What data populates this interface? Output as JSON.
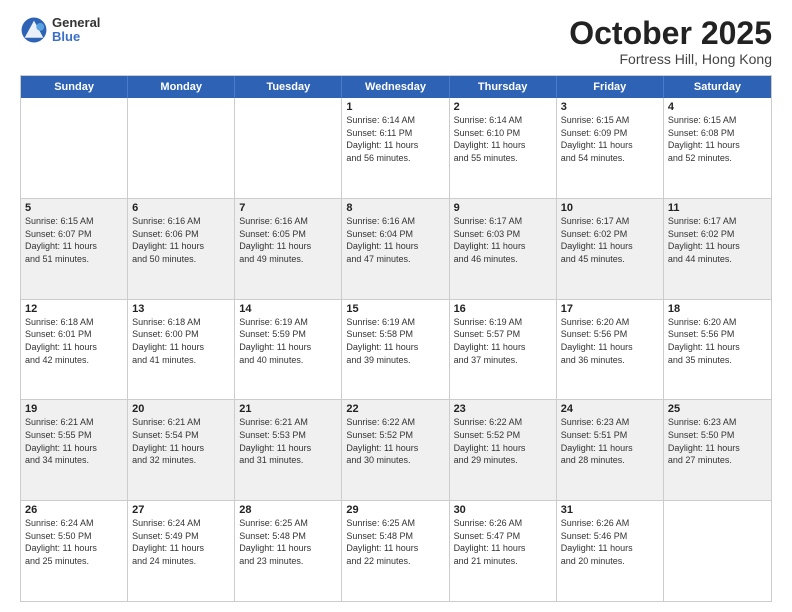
{
  "header": {
    "logo_line1": "General",
    "logo_line2": "Blue",
    "title": "October 2025",
    "location": "Fortress Hill, Hong Kong"
  },
  "days_of_week": [
    "Sunday",
    "Monday",
    "Tuesday",
    "Wednesday",
    "Thursday",
    "Friday",
    "Saturday"
  ],
  "weeks": [
    [
      {
        "day": "",
        "info": ""
      },
      {
        "day": "",
        "info": ""
      },
      {
        "day": "",
        "info": ""
      },
      {
        "day": "1",
        "info": "Sunrise: 6:14 AM\nSunset: 6:11 PM\nDaylight: 11 hours\nand 56 minutes."
      },
      {
        "day": "2",
        "info": "Sunrise: 6:14 AM\nSunset: 6:10 PM\nDaylight: 11 hours\nand 55 minutes."
      },
      {
        "day": "3",
        "info": "Sunrise: 6:15 AM\nSunset: 6:09 PM\nDaylight: 11 hours\nand 54 minutes."
      },
      {
        "day": "4",
        "info": "Sunrise: 6:15 AM\nSunset: 6:08 PM\nDaylight: 11 hours\nand 52 minutes."
      }
    ],
    [
      {
        "day": "5",
        "info": "Sunrise: 6:15 AM\nSunset: 6:07 PM\nDaylight: 11 hours\nand 51 minutes."
      },
      {
        "day": "6",
        "info": "Sunrise: 6:16 AM\nSunset: 6:06 PM\nDaylight: 11 hours\nand 50 minutes."
      },
      {
        "day": "7",
        "info": "Sunrise: 6:16 AM\nSunset: 6:05 PM\nDaylight: 11 hours\nand 49 minutes."
      },
      {
        "day": "8",
        "info": "Sunrise: 6:16 AM\nSunset: 6:04 PM\nDaylight: 11 hours\nand 47 minutes."
      },
      {
        "day": "9",
        "info": "Sunrise: 6:17 AM\nSunset: 6:03 PM\nDaylight: 11 hours\nand 46 minutes."
      },
      {
        "day": "10",
        "info": "Sunrise: 6:17 AM\nSunset: 6:02 PM\nDaylight: 11 hours\nand 45 minutes."
      },
      {
        "day": "11",
        "info": "Sunrise: 6:17 AM\nSunset: 6:02 PM\nDaylight: 11 hours\nand 44 minutes."
      }
    ],
    [
      {
        "day": "12",
        "info": "Sunrise: 6:18 AM\nSunset: 6:01 PM\nDaylight: 11 hours\nand 42 minutes."
      },
      {
        "day": "13",
        "info": "Sunrise: 6:18 AM\nSunset: 6:00 PM\nDaylight: 11 hours\nand 41 minutes."
      },
      {
        "day": "14",
        "info": "Sunrise: 6:19 AM\nSunset: 5:59 PM\nDaylight: 11 hours\nand 40 minutes."
      },
      {
        "day": "15",
        "info": "Sunrise: 6:19 AM\nSunset: 5:58 PM\nDaylight: 11 hours\nand 39 minutes."
      },
      {
        "day": "16",
        "info": "Sunrise: 6:19 AM\nSunset: 5:57 PM\nDaylight: 11 hours\nand 37 minutes."
      },
      {
        "day": "17",
        "info": "Sunrise: 6:20 AM\nSunset: 5:56 PM\nDaylight: 11 hours\nand 36 minutes."
      },
      {
        "day": "18",
        "info": "Sunrise: 6:20 AM\nSunset: 5:56 PM\nDaylight: 11 hours\nand 35 minutes."
      }
    ],
    [
      {
        "day": "19",
        "info": "Sunrise: 6:21 AM\nSunset: 5:55 PM\nDaylight: 11 hours\nand 34 minutes."
      },
      {
        "day": "20",
        "info": "Sunrise: 6:21 AM\nSunset: 5:54 PM\nDaylight: 11 hours\nand 32 minutes."
      },
      {
        "day": "21",
        "info": "Sunrise: 6:21 AM\nSunset: 5:53 PM\nDaylight: 11 hours\nand 31 minutes."
      },
      {
        "day": "22",
        "info": "Sunrise: 6:22 AM\nSunset: 5:52 PM\nDaylight: 11 hours\nand 30 minutes."
      },
      {
        "day": "23",
        "info": "Sunrise: 6:22 AM\nSunset: 5:52 PM\nDaylight: 11 hours\nand 29 minutes."
      },
      {
        "day": "24",
        "info": "Sunrise: 6:23 AM\nSunset: 5:51 PM\nDaylight: 11 hours\nand 28 minutes."
      },
      {
        "day": "25",
        "info": "Sunrise: 6:23 AM\nSunset: 5:50 PM\nDaylight: 11 hours\nand 27 minutes."
      }
    ],
    [
      {
        "day": "26",
        "info": "Sunrise: 6:24 AM\nSunset: 5:50 PM\nDaylight: 11 hours\nand 25 minutes."
      },
      {
        "day": "27",
        "info": "Sunrise: 6:24 AM\nSunset: 5:49 PM\nDaylight: 11 hours\nand 24 minutes."
      },
      {
        "day": "28",
        "info": "Sunrise: 6:25 AM\nSunset: 5:48 PM\nDaylight: 11 hours\nand 23 minutes."
      },
      {
        "day": "29",
        "info": "Sunrise: 6:25 AM\nSunset: 5:48 PM\nDaylight: 11 hours\nand 22 minutes."
      },
      {
        "day": "30",
        "info": "Sunrise: 6:26 AM\nSunset: 5:47 PM\nDaylight: 11 hours\nand 21 minutes."
      },
      {
        "day": "31",
        "info": "Sunrise: 6:26 AM\nSunset: 5:46 PM\nDaylight: 11 hours\nand 20 minutes."
      },
      {
        "day": "",
        "info": ""
      }
    ]
  ],
  "shaded_weeks": [
    1,
    3
  ],
  "accent_color": "#2e62b5"
}
